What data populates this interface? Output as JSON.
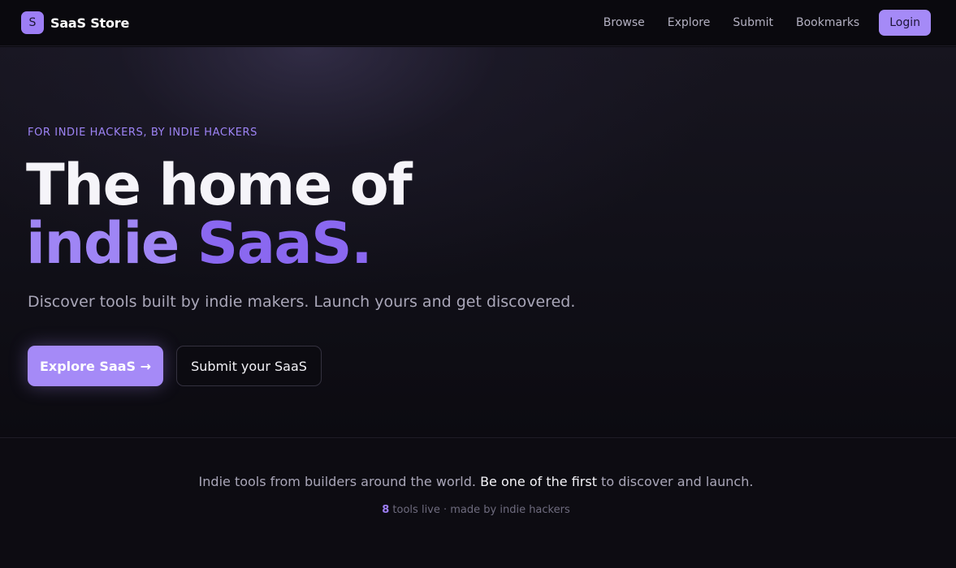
{
  "nav": {
    "logo_letter": "S",
    "brand": "SaaS Store",
    "links": [
      "Browse",
      "Explore",
      "Submit",
      "Bookmarks"
    ],
    "login_label": "Login"
  },
  "hero": {
    "eyebrow": "FOR INDIE HACKERS, BY INDIE HACKERS",
    "headline_line1": "The home of",
    "headline_line2_a": "indie ",
    "headline_line2_b": "SaaS.",
    "subtext": "Discover tools built by indie makers. Launch yours and get discovered.",
    "primary_cta": "Explore SaaS →",
    "secondary_cta": "Submit your SaaS"
  },
  "footer": {
    "tagline_a": "Indie tools from builders around the world. ",
    "tagline_highlight": "Be one of the first",
    "tagline_b": " to discover and launch.",
    "tools_count": "8",
    "stats_suffix": " tools live · made by indie hackers"
  },
  "colors": {
    "accent": "#a58af7",
    "background": "#0b0a10"
  }
}
